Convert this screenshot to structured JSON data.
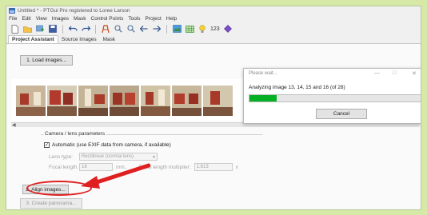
{
  "window": {
    "title": "Untitled * - PTGui Pro registered to Loree Larson"
  },
  "menu": [
    "File",
    "Edit",
    "View",
    "Images",
    "Mask",
    "Control Points",
    "Tools",
    "Project",
    "Help"
  ],
  "toolbar": {
    "counter": "123"
  },
  "tabs": [
    "Project Assistant",
    "Source Images",
    "Mask"
  ],
  "assistant": {
    "load_button": "1. Load images...",
    "align_button": "2. Align images...",
    "create_button": "3. Create panorama..."
  },
  "camera": {
    "group_title": "Camera / lens parameters",
    "automatic_label": "Automatic (use EXIF data from camera, if available)",
    "automatic_checked": true,
    "lens_type_label": "Lens type:",
    "lens_type_value": "Rectilinear (normal lens)",
    "focal_length_label": "Focal length:",
    "focal_length_value": "18",
    "focal_unit": "mm,",
    "multiplier_label": "Focal length multiplier:",
    "multiplier_value": "1.613",
    "multiplier_suffix": "x"
  },
  "dialog": {
    "title": "Please wait...",
    "message": "Analyzing image 13, 14, 15 and 16 (of 28)",
    "progress_fraction": 0.16,
    "cancel_button": "Cancel"
  },
  "colors": {
    "progress": "#06b025",
    "annotation": "#e02020",
    "background": "#d7e9a6"
  }
}
